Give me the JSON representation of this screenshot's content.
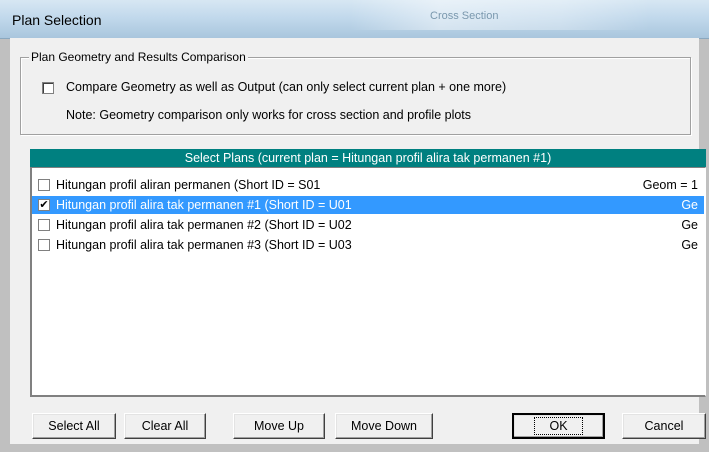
{
  "window": {
    "title": "Plan Selection",
    "background_title": "Cross Section"
  },
  "comparison_group": {
    "legend": "Plan Geometry and Results Comparison",
    "compare_checkbox_label": "Compare Geometry as well as Output (can only select current plan + one more)",
    "compare_checked": false,
    "note": "Note: Geometry comparison only works for cross section and profile plots"
  },
  "plans_list": {
    "header": "Select Plans  (current plan = Hitungan profil alira tak permanen #1)",
    "items": [
      {
        "name": "Hitungan profil aliran permanen  (Short ID = S01",
        "geom": "Geom = 1",
        "checked": false,
        "selected": false
      },
      {
        "name": "Hitungan profil alira tak permanen #1  (Short ID = U01",
        "geom": "Ge",
        "checked": true,
        "selected": true
      },
      {
        "name": "Hitungan profil alira tak permanen #2  (Short ID = U02",
        "geom": "Ge",
        "checked": false,
        "selected": false
      },
      {
        "name": "Hitungan profil alira tak permanen #3  (Short ID = U03",
        "geom": "Ge",
        "checked": false,
        "selected": false
      }
    ]
  },
  "buttons": {
    "select_all": "Select All",
    "clear_all": "Clear All",
    "move_up": "Move Up",
    "move_down": "Move Down",
    "ok": "OK",
    "cancel": "Cancel"
  },
  "colors": {
    "header_teal": "#008080",
    "selection_blue": "#3399ff",
    "dialog_bg": "#f0f0f0"
  },
  "glyphs": {
    "checkmark": "✔"
  }
}
